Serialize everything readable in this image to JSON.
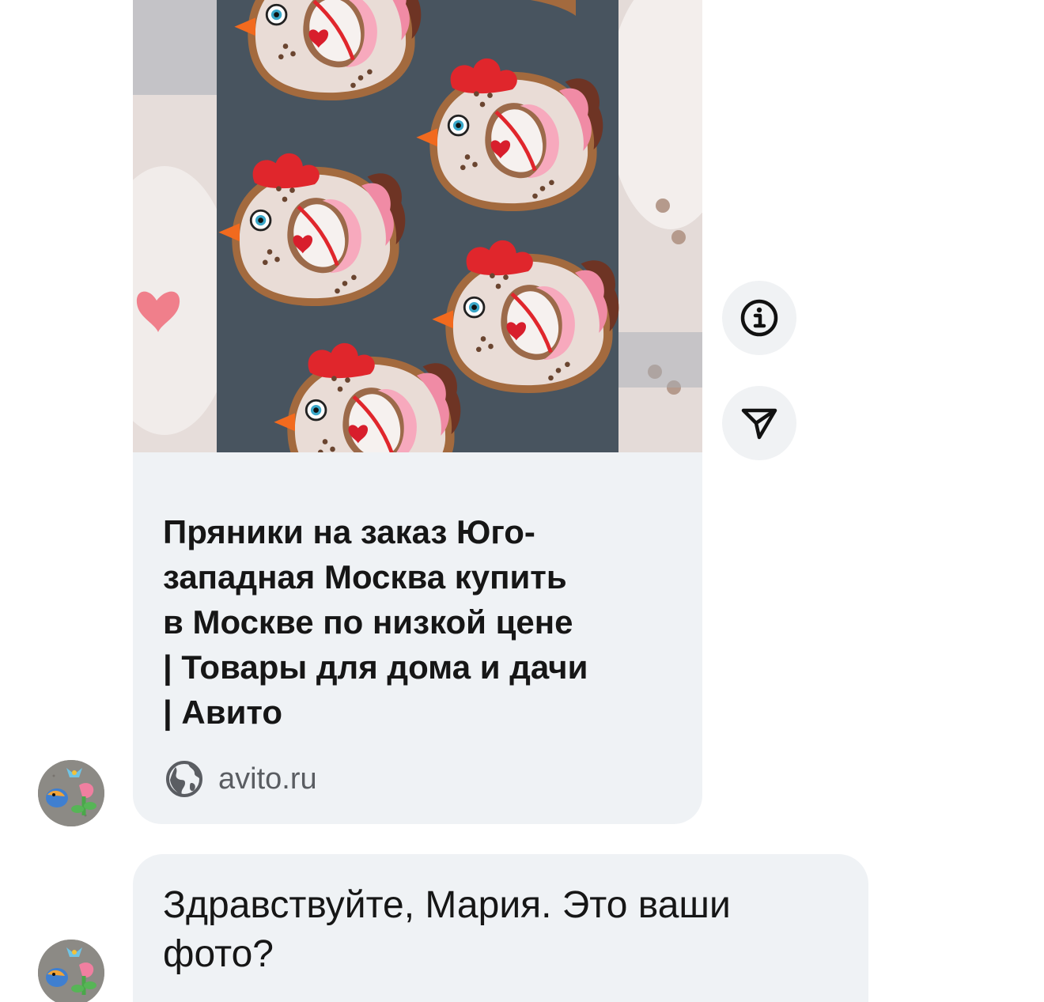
{
  "link_preview": {
    "image_alt": "Пряники в форме курочек",
    "title": "Пряники на заказ Юго-\nзападная Москва купить\nв Москве по низкой цене\n| Товары для дома и дачи\n| Авито",
    "domain": "avito.ru",
    "domain_icon": "globe-icon"
  },
  "actions": {
    "info_icon": "info-icon",
    "share_icon": "share-icon"
  },
  "messages": [
    {
      "text": "Здравствуйте, Мария. Это ваши фото?"
    }
  ],
  "colors": {
    "bubble_background": "#eff2f5",
    "text_primary": "#161616",
    "text_secondary": "#5a5d62"
  }
}
